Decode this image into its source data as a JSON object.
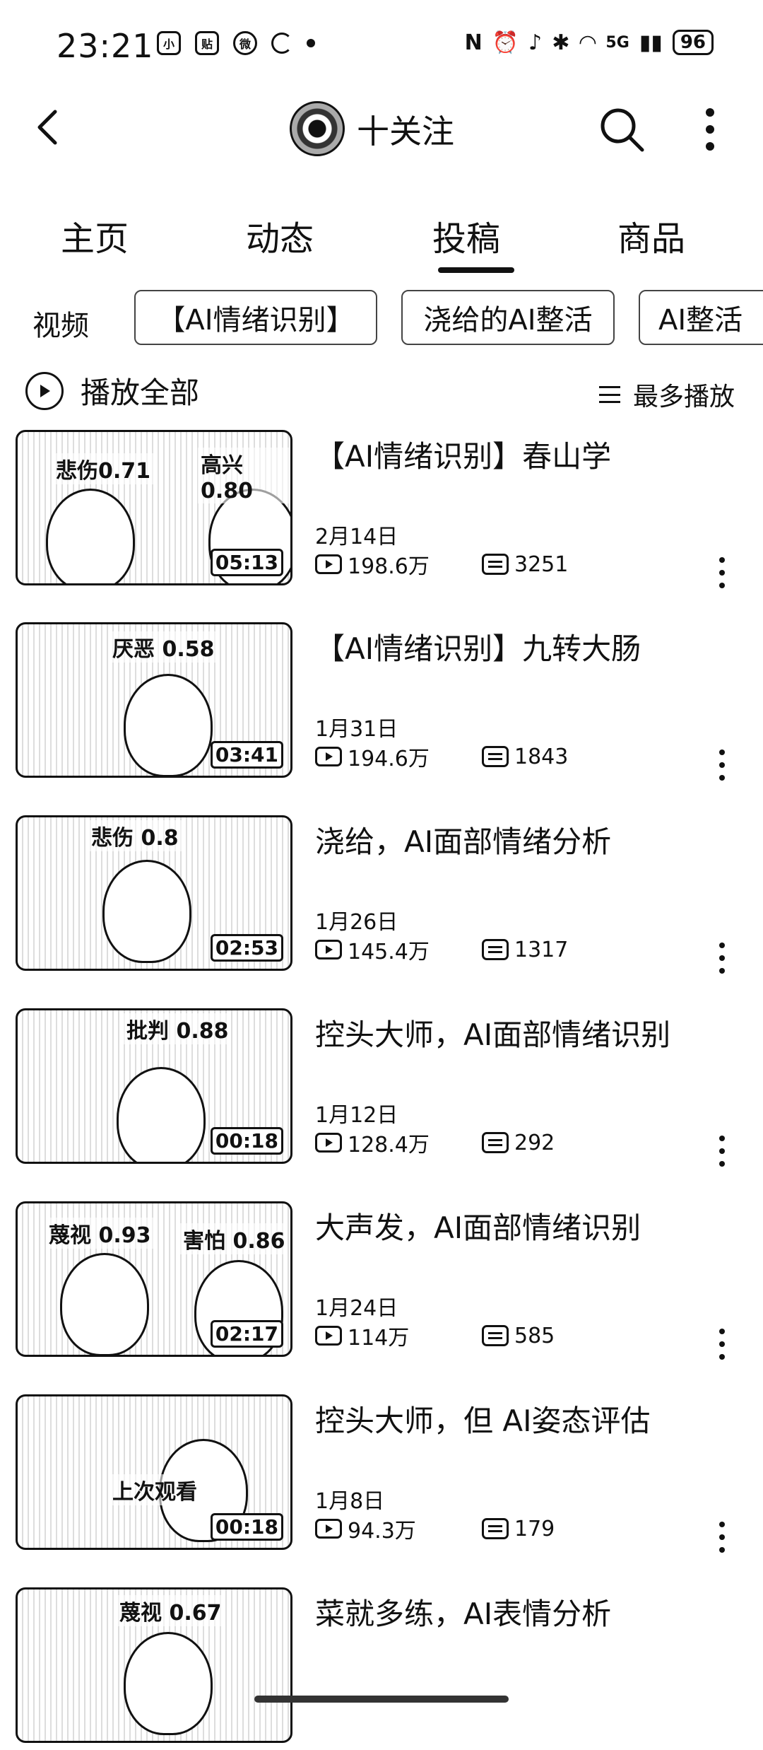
{
  "status": {
    "time": "23:21",
    "notif_icons": [
      "小红书",
      "贴",
      "weibo-icon",
      "sync-icon",
      "dot"
    ],
    "battery": "96",
    "network": "5G"
  },
  "header": {
    "follow_label": "十关注"
  },
  "tabs": [
    {
      "label": "主页",
      "active": false
    },
    {
      "label": "动态",
      "active": false
    },
    {
      "label": "投稿",
      "active": true
    },
    {
      "label": "商品",
      "active": false
    }
  ],
  "chips": {
    "label": "视频",
    "items": [
      "【AI情绪识别】",
      "浇给的AI整活",
      "AI整活"
    ]
  },
  "list_controls": {
    "play_all": "播放全部",
    "sort": "最多播放"
  },
  "videos": [
    {
      "title": "【AI情绪识别】春山学",
      "date": "2月14日",
      "views": "198.6万",
      "comments": "3251",
      "duration": "05:13",
      "emotions": [
        "悲伤0.71",
        "高兴0.80"
      ]
    },
    {
      "title": "【AI情绪识别】九转大肠",
      "date": "1月31日",
      "views": "194.6万",
      "comments": "1843",
      "duration": "03:41",
      "emotions": [
        "厌恶 0.58"
      ]
    },
    {
      "title": "浇给，AI面部情绪分析",
      "date": "1月26日",
      "views": "145.4万",
      "comments": "1317",
      "duration": "02:53",
      "emotions": [
        "悲伤 0.8"
      ]
    },
    {
      "title": "控头大师，AI面部情绪识别",
      "date": "1月12日",
      "views": "128.4万",
      "comments": "292",
      "duration": "00:18",
      "emotions": [
        "批判 0.88"
      ]
    },
    {
      "title": "大声发，AI面部情绪识别",
      "date": "1月24日",
      "views": "114万",
      "comments": "585",
      "duration": "02:17",
      "emotions": [
        "蔑视 0.93",
        "害怕 0.86"
      ]
    },
    {
      "title": "控头大师，但 AI姿态评估",
      "date": "1月8日",
      "views": "94.3万",
      "comments": "179",
      "duration": "00:18",
      "emotions": [
        "上次观看"
      ]
    },
    {
      "title": "菜就多练，AI表情分析",
      "date": "",
      "views": "",
      "comments": "",
      "duration": "",
      "emotions": [
        "蔑视 0.67"
      ]
    }
  ]
}
